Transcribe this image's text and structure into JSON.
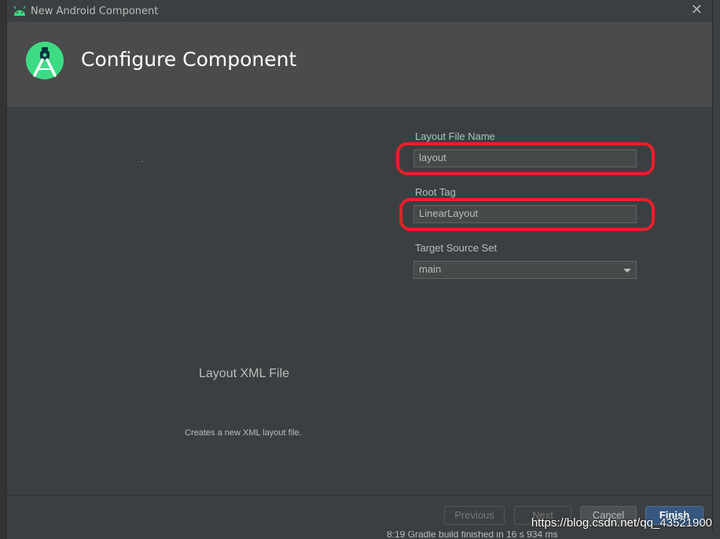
{
  "window": {
    "title": "New Android Component",
    "close_glyph": "✕"
  },
  "header": {
    "title": "Configure Component",
    "logo_icon": "android-studio-logo-icon"
  },
  "component": {
    "name": "Layout XML File",
    "description": "Creates a new XML layout file."
  },
  "form": {
    "layout_file_name": {
      "label": "Layout File Name",
      "value": "layout"
    },
    "root_tag": {
      "label": "Root Tag",
      "value": "LinearLayout"
    },
    "target_source_set": {
      "label": "Target Source Set",
      "value": "main"
    }
  },
  "buttons": {
    "previous": "Previous",
    "next": "Next",
    "cancel": "Cancel",
    "finish": "Finish"
  },
  "status": {
    "text": "8:19  Gradle build finished in 16 s 934 ms"
  },
  "watermark": "https://blog.csdn.net/qq_43521900",
  "colors": {
    "accent": "#365880",
    "highlight": "#e8202a",
    "android_green": "#3ddc84"
  }
}
